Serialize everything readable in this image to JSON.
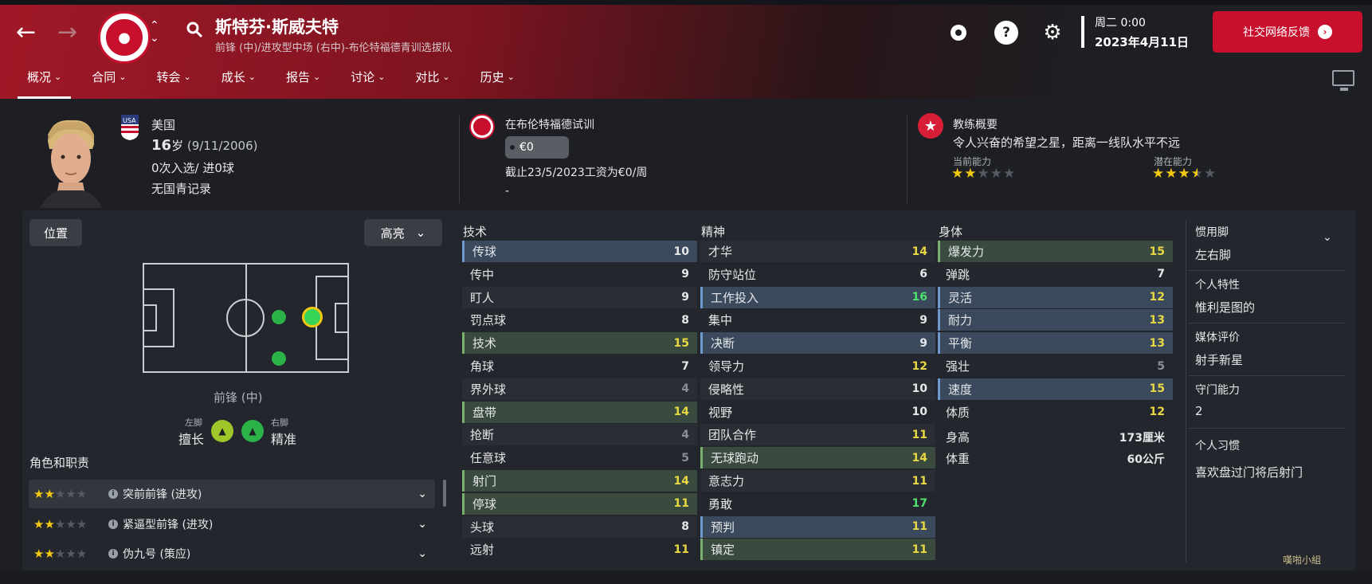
{
  "header": {
    "player_name": "斯特芬·斯威夫特",
    "subtitle": "前锋 (中)/进攻型中场 (右中)-布伦特福德青训选拔队",
    "day": "周二 0:00",
    "date": "2023年4月11日",
    "social_label": "社交网络反馈",
    "icons": [
      "back-arrow-icon",
      "forward-arrow-icon",
      "club-crest",
      "chevron-updown-icon",
      "search-icon",
      "ball-icon",
      "help-icon",
      "gear-icon",
      "monitor-icon"
    ]
  },
  "tabs": [
    "概况",
    "合同",
    "转会",
    "成长",
    "报告",
    "讨论",
    "对比",
    "历史"
  ],
  "profile": {
    "nationality": "美国",
    "age_num": "16",
    "age_unit": "岁",
    "birth": "(9/11/2006)",
    "caps": "0次入选/ 进0球",
    "youth": "无国青记录"
  },
  "trial": {
    "title": "在布伦特福德试训",
    "wage_pill": "€0",
    "contract": "截止23/5/2023工资为€0/周",
    "dash": "-"
  },
  "coach": {
    "title": "教练概要",
    "summary": "令人兴奋的希望之星，距离一线队水平不远",
    "current_label": "当前能力",
    "potential_label": "潜在能力",
    "current_stars": 2,
    "potential_stars": 3.5
  },
  "left_panel": {
    "position_btn": "位置",
    "highlight_btn": "高亮",
    "position_label": "前锋 (中)",
    "left_foot_label": "左脚",
    "right_foot_label": "右脚",
    "left_foot_value": "擅长",
    "right_foot_value": "精准",
    "roles_title": "角色和职责",
    "roles": [
      {
        "stars": 2,
        "name": "突前前锋 (进攻)"
      },
      {
        "stars": 2,
        "name": "紧逼型前锋 (进攻)"
      },
      {
        "stars": 2,
        "name": "伪九号 (策应)"
      }
    ]
  },
  "attributes": {
    "technical_title": "技术",
    "mental_title": "精神",
    "physical_title": "身体",
    "technical": [
      {
        "n": "传球",
        "v": "10",
        "h": "b",
        "c": "w"
      },
      {
        "n": "传中",
        "v": "9",
        "h": "",
        "c": "w"
      },
      {
        "n": "盯人",
        "v": "9",
        "h": "",
        "c": "w"
      },
      {
        "n": "罚点球",
        "v": "8",
        "h": "",
        "c": "w"
      },
      {
        "n": "技术",
        "v": "15",
        "h": "g",
        "c": "y"
      },
      {
        "n": "角球",
        "v": "7",
        "h": "",
        "c": "w"
      },
      {
        "n": "界外球",
        "v": "4",
        "h": "",
        "c": "g"
      },
      {
        "n": "盘带",
        "v": "14",
        "h": "g",
        "c": "y"
      },
      {
        "n": "抢断",
        "v": "4",
        "h": "",
        "c": "g"
      },
      {
        "n": "任意球",
        "v": "5",
        "h": "",
        "c": "g"
      },
      {
        "n": "射门",
        "v": "14",
        "h": "g",
        "c": "y"
      },
      {
        "n": "停球",
        "v": "11",
        "h": "g",
        "c": "y"
      },
      {
        "n": "头球",
        "v": "8",
        "h": "",
        "c": "w"
      },
      {
        "n": "远射",
        "v": "11",
        "h": "",
        "c": "y"
      }
    ],
    "mental": [
      {
        "n": "才华",
        "v": "14",
        "h": "",
        "c": "y"
      },
      {
        "n": "防守站位",
        "v": "6",
        "h": "",
        "c": "w"
      },
      {
        "n": "工作投入",
        "v": "16",
        "h": "b",
        "c": "gr"
      },
      {
        "n": "集中",
        "v": "9",
        "h": "",
        "c": "w"
      },
      {
        "n": "决断",
        "v": "9",
        "h": "b",
        "c": "w"
      },
      {
        "n": "领导力",
        "v": "12",
        "h": "",
        "c": "y"
      },
      {
        "n": "侵略性",
        "v": "10",
        "h": "",
        "c": "w"
      },
      {
        "n": "视野",
        "v": "10",
        "h": "",
        "c": "w"
      },
      {
        "n": "团队合作",
        "v": "11",
        "h": "",
        "c": "y"
      },
      {
        "n": "无球跑动",
        "v": "14",
        "h": "g",
        "c": "y"
      },
      {
        "n": "意志力",
        "v": "11",
        "h": "",
        "c": "y"
      },
      {
        "n": "勇敢",
        "v": "17",
        "h": "",
        "c": "gr"
      },
      {
        "n": "预判",
        "v": "11",
        "h": "b",
        "c": "y"
      },
      {
        "n": "镇定",
        "v": "11",
        "h": "g",
        "c": "y"
      }
    ],
    "physical": [
      {
        "n": "爆发力",
        "v": "15",
        "h": "g",
        "c": "y"
      },
      {
        "n": "弹跳",
        "v": "7",
        "h": "",
        "c": "w"
      },
      {
        "n": "灵活",
        "v": "12",
        "h": "b",
        "c": "y"
      },
      {
        "n": "耐力",
        "v": "13",
        "h": "b",
        "c": "y"
      },
      {
        "n": "平衡",
        "v": "13",
        "h": "b",
        "c": "y"
      },
      {
        "n": "强壮",
        "v": "5",
        "h": "",
        "c": "g"
      },
      {
        "n": "速度",
        "v": "15",
        "h": "b",
        "c": "y"
      },
      {
        "n": "体质",
        "v": "12",
        "h": "",
        "c": "y"
      }
    ],
    "height_label": "身高",
    "height_value": "173厘米",
    "weight_label": "体重",
    "weight_value": "60公斤"
  },
  "sidebar": {
    "foot_label": "惯用脚",
    "foot_value": "左右脚",
    "trait_label": "个人特性",
    "trait_value": "惟利是图的",
    "media_label": "媒体评价",
    "media_value": "射手新星",
    "gk_label": "守门能力",
    "gk_value": "2",
    "habit_label": "个人习惯",
    "habit_value": "喜欢盘过门将后射门"
  },
  "watermark": "嘆啪小組"
}
